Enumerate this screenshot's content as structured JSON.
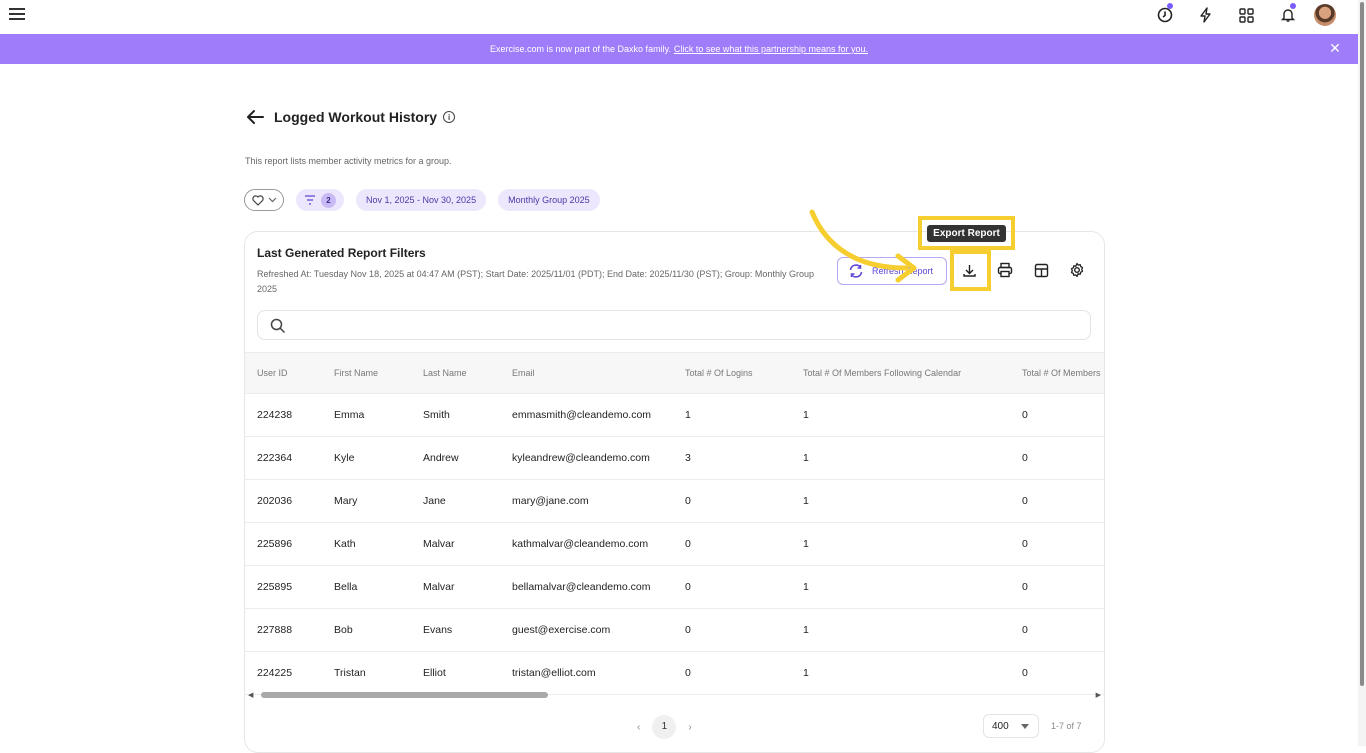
{
  "topbar": {
    "menu_icon": "hamburger-icon",
    "icons": [
      "clock-icon",
      "lightning-icon",
      "apps-grid-icon",
      "bell-icon"
    ]
  },
  "banner": {
    "text": "Exercise.com is now part of the Daxko family.",
    "link": "Click to see what this partnership means for you."
  },
  "page": {
    "title": "Logged Workout History",
    "description": "This report lists member activity metrics for a group."
  },
  "filters": {
    "filter_count": "2",
    "date_range": "Nov 1, 2025 - Nov 30, 2025",
    "group": "Monthly Group 2025"
  },
  "card": {
    "title": "Last Generated Report Filters",
    "subtitle": "Refreshed At: Tuesday Nov 18, 2025 at 04:47 AM (PST); Start Date: 2025/11/01 (PDT); End Date: 2025/11/30 (PST); Group: Monthly Group 2025",
    "refresh_label": "Refresh Report",
    "tooltip": "Export Report"
  },
  "table": {
    "headers": [
      "User ID",
      "First Name",
      "Last Name",
      "Email",
      "Total # Of Logins",
      "Total # Of Members Following Calendar",
      "Total # Of Members"
    ],
    "rows": [
      [
        "224238",
        "Emma",
        "Smith",
        "emmasmith@cleandemo.com",
        "1",
        "1",
        "0"
      ],
      [
        "222364",
        "Kyle",
        "Andrew",
        "kyleandrew@cleandemo.com",
        "3",
        "1",
        "0"
      ],
      [
        "202036",
        "Mary",
        "Jane",
        "mary@jane.com",
        "0",
        "1",
        "0"
      ],
      [
        "225896",
        "Kath",
        "Malvar",
        "kathmalvar@cleandemo.com",
        "0",
        "1",
        "0"
      ],
      [
        "225895",
        "Bella",
        "Malvar",
        "bellamalvar@cleandemo.com",
        "0",
        "1",
        "0"
      ],
      [
        "227888",
        "Bob",
        "Evans",
        "guest@exercise.com",
        "0",
        "1",
        "0"
      ],
      [
        "224225",
        "Tristan",
        "Elliot",
        "tristan@elliot.com",
        "0",
        "1",
        "0"
      ]
    ]
  },
  "pagination": {
    "current": "1",
    "per_page": "400",
    "count": "1-7 of 7"
  },
  "colors": {
    "accent": "#9f7cf9",
    "highlight": "#f6ce2f"
  }
}
